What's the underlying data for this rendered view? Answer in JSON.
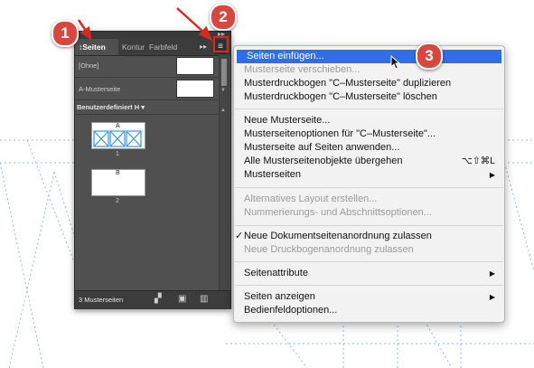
{
  "panel": {
    "tabs": [
      "Seiten",
      "Kontur",
      "Farbfelder"
    ],
    "tabs_display": [
      "↕Seiten",
      "Kontur",
      "Farbfeld"
    ],
    "more_icon": "double-chevron-right",
    "menu_icon": "≡",
    "masters": [
      {
        "label": "[Ohne]"
      },
      {
        "label": "A-Musterseite"
      }
    ],
    "dropdown_label": "Benutzerdefiniert H ▾",
    "pages": [
      {
        "prefix": "A",
        "number": "1"
      },
      {
        "prefix": "B",
        "number": "2"
      }
    ],
    "footer": {
      "count": "3 Musterseiten"
    }
  },
  "menu": {
    "groups": [
      [
        {
          "label": "Seiten einfügen...",
          "state": "highlighted"
        },
        {
          "label": "Musterseite verschieben...",
          "state": "disabled"
        },
        {
          "label": "Musterdruckbogen \"C–Musterseite\" duplizieren",
          "state": "enabled"
        },
        {
          "label": "Musterdruckbogen \"C–Musterseite\" löschen",
          "state": "enabled"
        }
      ],
      [
        {
          "label": "Neue Musterseite...",
          "state": "enabled"
        },
        {
          "label": "Musterseitenoptionen für \"C–Musterseite\"...",
          "state": "enabled"
        },
        {
          "label": "Musterseite auf Seiten anwenden...",
          "state": "enabled"
        },
        {
          "label": "Alle Musterseitenobjekte übergehen",
          "state": "enabled",
          "shortcut": "⌥⇧⌘L"
        },
        {
          "label": "Musterseiten",
          "state": "enabled",
          "submenu": true
        }
      ],
      [
        {
          "label": "Alternatives Layout erstellen...",
          "state": "disabled"
        },
        {
          "label": "Nummerierungs- und Abschnittsoptionen...",
          "state": "disabled"
        }
      ],
      [
        {
          "label": "Neue Dokumentseitenanordnung zulassen",
          "state": "checked"
        },
        {
          "label": "Neue Druckbogenanordnung zulassen",
          "state": "disabled"
        }
      ],
      [
        {
          "label": "Seitenattribute",
          "state": "enabled",
          "submenu": true
        }
      ],
      [
        {
          "label": "Seiten anzeigen",
          "state": "enabled",
          "submenu": true
        },
        {
          "label": "Bedienfeldoptionen...",
          "state": "enabled"
        }
      ]
    ]
  },
  "callouts": [
    "1",
    "2",
    "3"
  ],
  "colors": {
    "highlight": "#2f6ee6",
    "callout": "#d6483e",
    "panel_bg": "#505050",
    "guides": "#7fb3e0"
  }
}
